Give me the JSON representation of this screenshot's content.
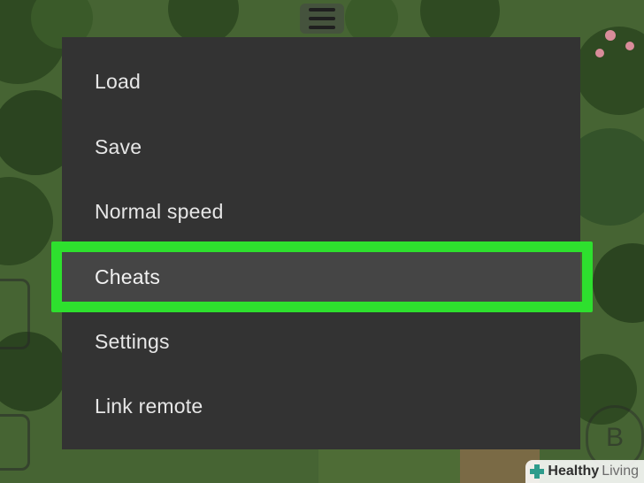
{
  "menu": {
    "items": [
      {
        "label": "Load"
      },
      {
        "label": "Save"
      },
      {
        "label": "Normal speed"
      },
      {
        "label": "Cheats",
        "selected": true
      },
      {
        "label": "Settings"
      },
      {
        "label": "Link remote"
      }
    ]
  },
  "controls": {
    "b_button_label": "B"
  },
  "watermark": {
    "part1": "Healthy",
    "part2": "Living"
  },
  "colors": {
    "menu_background": "#333333",
    "highlight": "#2ee02e",
    "menu_text": "#e6e6e6"
  }
}
